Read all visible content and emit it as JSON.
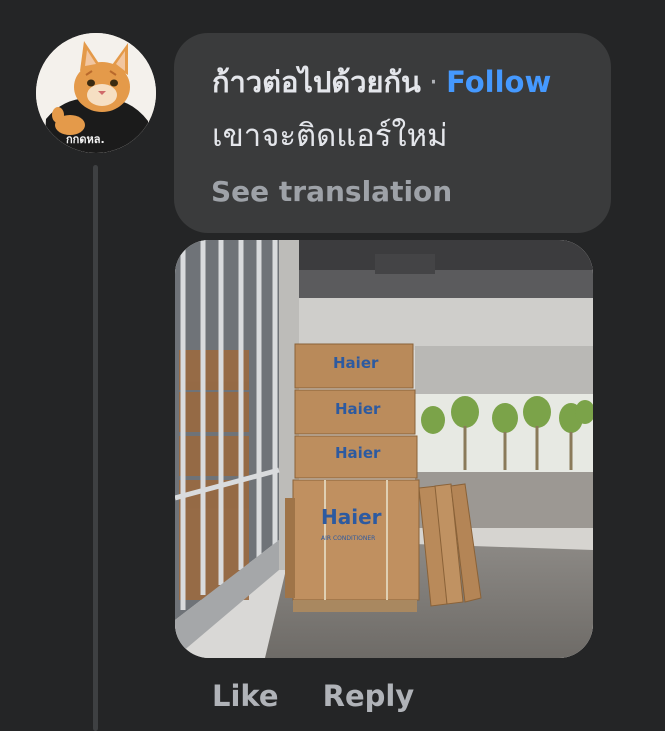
{
  "comment": {
    "author": "ก้าวต่อไปด้วยกัน",
    "separator": "·",
    "follow_label": "Follow",
    "text": "เขาจะติดแอร์ใหม่",
    "see_translation_label": "See translation",
    "avatar_shirt_text": "กกดหล.",
    "photo": {
      "box_brand": "Haier",
      "box_caption": "AIR CONDITIONER"
    },
    "actions": {
      "like_label": "Like",
      "reply_label": "Reply"
    }
  },
  "colors": {
    "background": "#242526",
    "bubble": "#3a3b3c",
    "primary_text": "#e4e6eb",
    "secondary_text": "#b0b3b8",
    "follow_link": "#4599ff",
    "thread_line": "#3e4042"
  }
}
